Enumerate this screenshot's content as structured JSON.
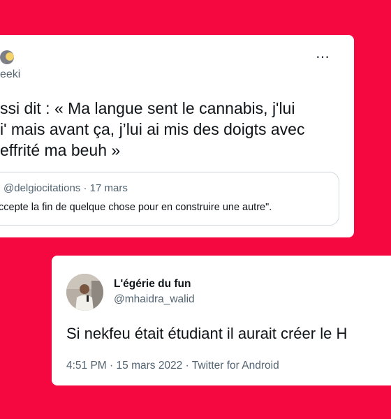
{
  "tweet1": {
    "handle": "eeki",
    "more_icon": "⋯",
    "text_lines": [
      "ssi dit : « Ma langue sent le cannabis, j'lui",
      "i' mais avant ça, j’lui ai mis des doigts avec",
      "effrité ma beuh »"
    ],
    "quote": {
      "handle": "@delgiocitations",
      "separator": " · ",
      "date": "17 mars",
      "text": "ccepte la fin de quelque chose pour en construire une autre\"."
    }
  },
  "tweet2": {
    "display_name": "L'égérie du fun",
    "handle": "@mhaidra_walid",
    "text": "Si nekfeu était étudiant il aurait créer le H",
    "time": "4:51 PM",
    "separator1": " · ",
    "date": "15 mars 2022",
    "separator2": " · ",
    "source": "Twitter for Android"
  },
  "colors": {
    "background": "#f5073f",
    "card": "#ffffff",
    "primary_text": "#0f1419",
    "secondary_text": "#536471"
  }
}
